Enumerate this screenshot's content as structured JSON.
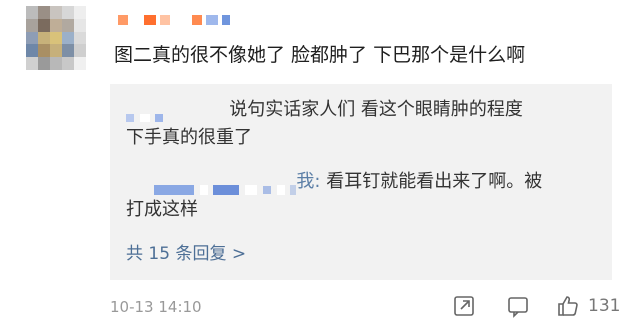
{
  "comment": {
    "text": "图二真的很不像她了 脸都肿了 下巴那个是什么啊",
    "time": "10-13 14:10",
    "like_count": "131"
  },
  "replies": [
    {
      "text_line1": "说句实话家人们 看这个眼睛肿的程度",
      "text_line2": "下手真的很重了"
    },
    {
      "name_tail": "我:",
      "text_line1": " 看耳钉就能看出来了啊。被",
      "text_line2": "打成这样"
    }
  ],
  "reply_count_label": "共 15 条回复 >",
  "colors": {
    "accent_link": "#4d6f96",
    "reply_background": "#f2f2f2",
    "mosaic_orange": "#ff7a3c",
    "mosaic_blue": "#7aa3e6"
  },
  "icons": {
    "share": "share-icon",
    "comment": "comment-icon",
    "like": "thumbs-up-icon"
  }
}
